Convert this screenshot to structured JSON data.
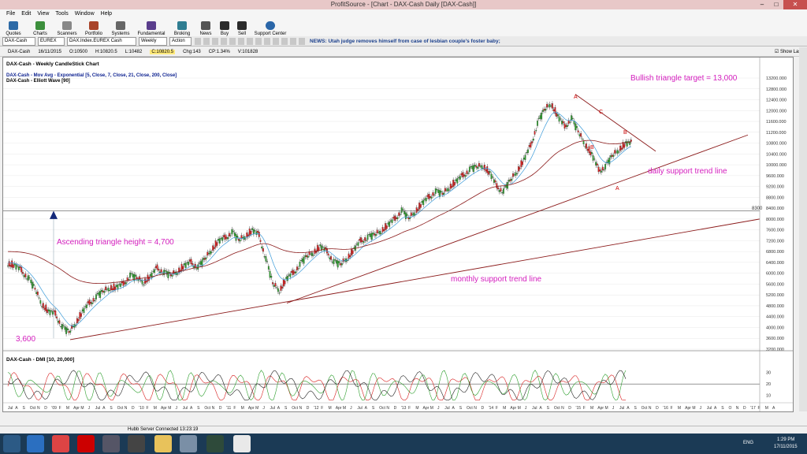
{
  "window": {
    "title": "ProfitSource - [Chart - DAX-Cash Daily [DAX-Cash]]"
  },
  "menu": [
    "File",
    "Edit",
    "View",
    "Tools",
    "Window",
    "Help"
  ],
  "toolbar": [
    "Quotes",
    "Charts",
    "Scanners",
    "Portfolio",
    "Systems",
    "Fundamental",
    "Broking",
    "News",
    "Buy",
    "Sell",
    "Support Center"
  ],
  "symbolbar": {
    "symbol": "DAX-Cash",
    "exchange": "EUREX",
    "description": "DAX.Index.EUREX Cash",
    "period": "Weekly",
    "action": "Action",
    "news": "NEWS: Utah judge removes himself from case of lesbian couple's foster baby;"
  },
  "quote": {
    "symbol": "DAX-Cash",
    "date": "16/11/2015",
    "open": "O:10500",
    "high": "H:10820.5",
    "low": "L:10482",
    "close": "C:10820.5",
    "chg": "Chg:143",
    "chg_pct": "CP:1.34%",
    "volume": "V:101828",
    "show_last": "Show Last"
  },
  "legend": [
    "DAX-Cash - Weekly CandleStick Chart",
    "DAX-Cash - Mov Avg - Exponential [5, Close, 7, Close, 21, Close, 200, Close]",
    "DAX-Cash - Elliott Wave [90]"
  ],
  "colors": {
    "ema_fast": "#3a9ad9",
    "ema_slow": "#8b1a1a",
    "trend": "#8b1a1a",
    "annot": "#d41fbe",
    "grid": "#e8e8e8"
  },
  "annotations": {
    "target": "Bullish triangle target = 13,000",
    "daily": "daily support trend line",
    "height": "Ascending triangle height = 4,700",
    "monthly": "monthly support trend line",
    "low": "3,600",
    "line_label": "8300",
    "wave_A": "A",
    "wave_B": "B",
    "wave_C": "C",
    "wave_B2": "B",
    "wave_A2": "A"
  },
  "dmi": {
    "title": "DAX-Cash - DMI [10, 20,000]"
  },
  "status": {
    "text": "Hubb Server Connected 13:23:19"
  },
  "clock": {
    "time": "1:29 PM",
    "date": "17/11/2015",
    "lang": "ENG"
  },
  "chart_data": {
    "type": "candlestick",
    "title": "DAX-Cash - Weekly CandleStick Chart",
    "y_ticks": [
      13200,
      12800,
      12400,
      12000,
      11600,
      11200,
      10800,
      10400,
      10000,
      9600,
      9200,
      8800,
      8400,
      8000,
      7600,
      7200,
      6800,
      6400,
      6000,
      5600,
      5200,
      4800,
      4400,
      4000,
      3600,
      3200
    ],
    "dmi_ticks": [
      30,
      20,
      10
    ],
    "x_ticks": [
      "Jul",
      "A",
      "S",
      "Oct",
      "N",
      "D",
      "'09",
      "F",
      "M",
      "Apr",
      "M",
      "J",
      "Jul",
      "A",
      "S",
      "Oct",
      "N",
      "D",
      "'10",
      "F",
      "M",
      "Apr",
      "M",
      "J",
      "Jul",
      "A",
      "S",
      "Oct",
      "N",
      "D",
      "'11",
      "F",
      "M",
      "Apr",
      "M",
      "J",
      "Jul",
      "A",
      "S",
      "Oct",
      "N",
      "D",
      "'12",
      "F",
      "M",
      "Apr",
      "M",
      "J",
      "Jul",
      "A",
      "S",
      "Oct",
      "N",
      "D",
      "'13",
      "F",
      "M",
      "Apr",
      "M",
      "J",
      "Jul",
      "A",
      "S",
      "Oct",
      "N",
      "D",
      "'14",
      "F",
      "M",
      "Apr",
      "M",
      "J",
      "Jul",
      "A",
      "S",
      "Oct",
      "N",
      "D",
      "'15",
      "F",
      "M",
      "Apr",
      "M",
      "J",
      "Jul",
      "A",
      "S",
      "Oct",
      "N",
      "D",
      "'16",
      "F",
      "M",
      "Apr",
      "M",
      "J",
      "Jul",
      "A",
      "S",
      "O",
      "N",
      "D",
      "'17",
      "F",
      "M",
      "A"
    ],
    "closes": [
      6400,
      6300,
      6100,
      5800,
      5400,
      4900,
      4600,
      4500,
      4000,
      3800,
      4200,
      4600,
      4900,
      5100,
      5300,
      5500,
      5500,
      5600,
      5900,
      5800,
      5700,
      5900,
      6200,
      6000,
      5900,
      6100,
      6300,
      6400,
      6200,
      6500,
      6900,
      7200,
      7300,
      7500,
      7200,
      7400,
      7600,
      7400,
      6500,
      5600,
      5400,
      5800,
      6000,
      6300,
      6600,
      6800,
      7000,
      6800,
      6400,
      6300,
      6600,
      6900,
      7200,
      7300,
      7400,
      7600,
      7800,
      8000,
      8300,
      8000,
      8300,
      8600,
      8800,
      9000,
      8900,
      9200,
      9400,
      9600,
      9800,
      9900,
      10000,
      9700,
      9200,
      9000,
      9400,
      9800,
      10200,
      10700,
      11500,
      12000,
      12300,
      11800,
      11400,
      11700,
      11200,
      10800,
      10400,
      9800,
      9900,
      10300,
      10600,
      10800
    ],
    "horizontal_line": 8300
  }
}
